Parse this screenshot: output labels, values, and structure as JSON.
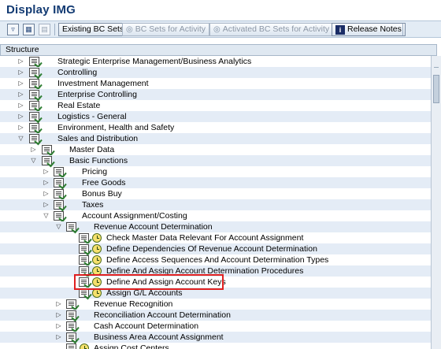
{
  "window": {
    "title": "Display IMG"
  },
  "toolbar": {
    "existing_bc_sets": "Existing BC Sets",
    "bc_sets_for_activity": "BC Sets for Activity",
    "activated_bc_sets": "Activated BC Sets for Activity",
    "release_notes": "Release Notes",
    "info_glyph": "i"
  },
  "structure_header": "Structure",
  "tree": {
    "strategic": "Strategic Enterprise Management/Business Analytics",
    "controlling": "Controlling",
    "investment": "Investment Management",
    "enterprise_controlling": "Enterprise Controlling",
    "real_estate": "Real Estate",
    "logistics": "Logistics - General",
    "ehs": "Environment, Health and Safety",
    "sd": "Sales and Distribution",
    "master_data": "Master Data",
    "basic_functions": "Basic Functions",
    "pricing": "Pricing",
    "free_goods": "Free Goods",
    "bonus_buy": "Bonus Buy",
    "taxes": "Taxes",
    "acct_assignment": "Account Assignment/Costing",
    "rev_acct_det": "Revenue Account Determination",
    "check_master": "Check Master Data Relevant For Account Assignment",
    "define_dependencies": "Define Dependencies Of Revenue Account Determination",
    "define_access": "Define Access Sequences And Account Determination Types",
    "define_assign_proc": "Define And Assign Account Determination Procedures",
    "define_assign_keys": "Define And Assign Account Keys",
    "assign_gl": "Assign G/L Accounts",
    "rev_recognition": "Revenue Recognition",
    "recon_acct_det": "Reconciliation Account Determination",
    "cash_acct_det": "Cash Account Determination",
    "business_area": "Business Area Account Assignment",
    "assign_cost_centers": "Assign Cost Centers"
  },
  "icons": {
    "tree_node": "document-check-icon",
    "activity": "clock-execute-icon"
  },
  "colors": {
    "title": "#133b73",
    "toolbar_bg": "#e3ecf5",
    "row_band": "#e4ecf6",
    "highlight_border": "#e02020"
  }
}
